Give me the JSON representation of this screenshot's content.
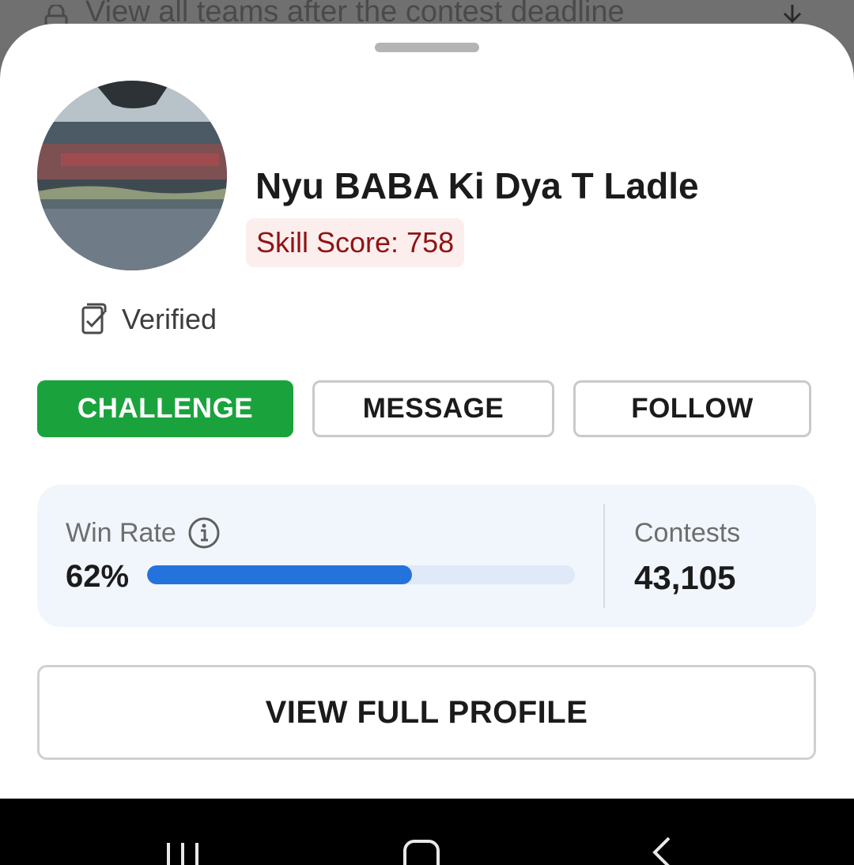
{
  "background": {
    "text": "View all teams after the contest deadline",
    "lock_icon": "lock-icon",
    "download_icon": "download-icon"
  },
  "profile": {
    "name": "Nyu BABA Ki Dya T Ladle",
    "skill_score": "Skill Score: 758",
    "verified_label": "Verified",
    "avatar_icon": "avatar-photo",
    "verified_icon": "verified-document-icon"
  },
  "actions": {
    "challenge_label": "CHALLENGE",
    "message_label": "MESSAGE",
    "follow_label": "FOLLOW"
  },
  "stats": {
    "win_rate_label": "Win Rate",
    "win_rate_value": "62%",
    "win_rate_fraction": 0.62,
    "contests_label": "Contests",
    "contests_value": "43,105"
  },
  "view_full_profile_label": "VIEW FULL PROFILE",
  "colors": {
    "accent_green": "#1aa33d",
    "progress_blue": "#2473dc",
    "skill_red": "#8e1414"
  }
}
